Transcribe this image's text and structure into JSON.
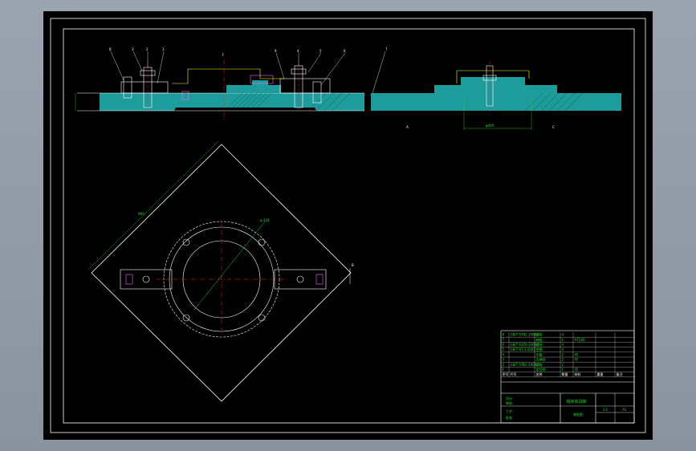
{
  "colors": {
    "background": "#000000",
    "frame": "#ffffff",
    "part_fill": "#1e9c9c",
    "centerline": "#ff2020",
    "dimension": "#20e020",
    "detail": "#ff60ff",
    "hidden": "#ffff20"
  },
  "section_view": {
    "balloons": [
      "8",
      "3",
      "2",
      "1",
      "9",
      "4",
      "5",
      "6"
    ],
    "axis_label": "F"
  },
  "right_section": {
    "balloons": [
      "7"
    ],
    "dimension_text": "φ440",
    "left_note": "A",
    "right_note": "C"
  },
  "plan_view": {
    "diagonal_dim": "960",
    "bolt_circle_label": "φ 330",
    "side_mark": "B"
  },
  "parts_list": {
    "rows": [
      [
        "8",
        "GB/T 5782-2000",
        "螺栓",
        "4",
        "",
        "",
        ""
      ],
      [
        "7",
        "",
        "底板",
        "1",
        "HT200",
        "",
        ""
      ],
      [
        "6",
        "GB/T 6170-2000",
        "螺母",
        "4",
        "",
        "",
        ""
      ],
      [
        "5",
        "GB/T 97.1-2002",
        "垫圈",
        "4",
        "",
        "",
        ""
      ],
      [
        "4",
        "",
        "压板",
        "2",
        "45",
        "",
        ""
      ],
      [
        "3",
        "",
        "支承钉",
        "2",
        "45",
        "",
        ""
      ],
      [
        "2",
        "GB/T 5781-2000",
        "螺栓",
        "2",
        "",
        "",
        ""
      ],
      [
        "1",
        "",
        "定位销",
        "1",
        "45",
        "",
        ""
      ]
    ],
    "header": [
      "序号",
      "代号",
      "名称",
      "数量",
      "材料",
      "重量",
      "备注"
    ]
  },
  "title_block": {
    "drawing_name": "铣床夹具体",
    "company": "装配图",
    "scale": "1:1",
    "sheet": "A1",
    "fields": [
      "设计",
      "审核",
      "工艺",
      "批准"
    ]
  }
}
